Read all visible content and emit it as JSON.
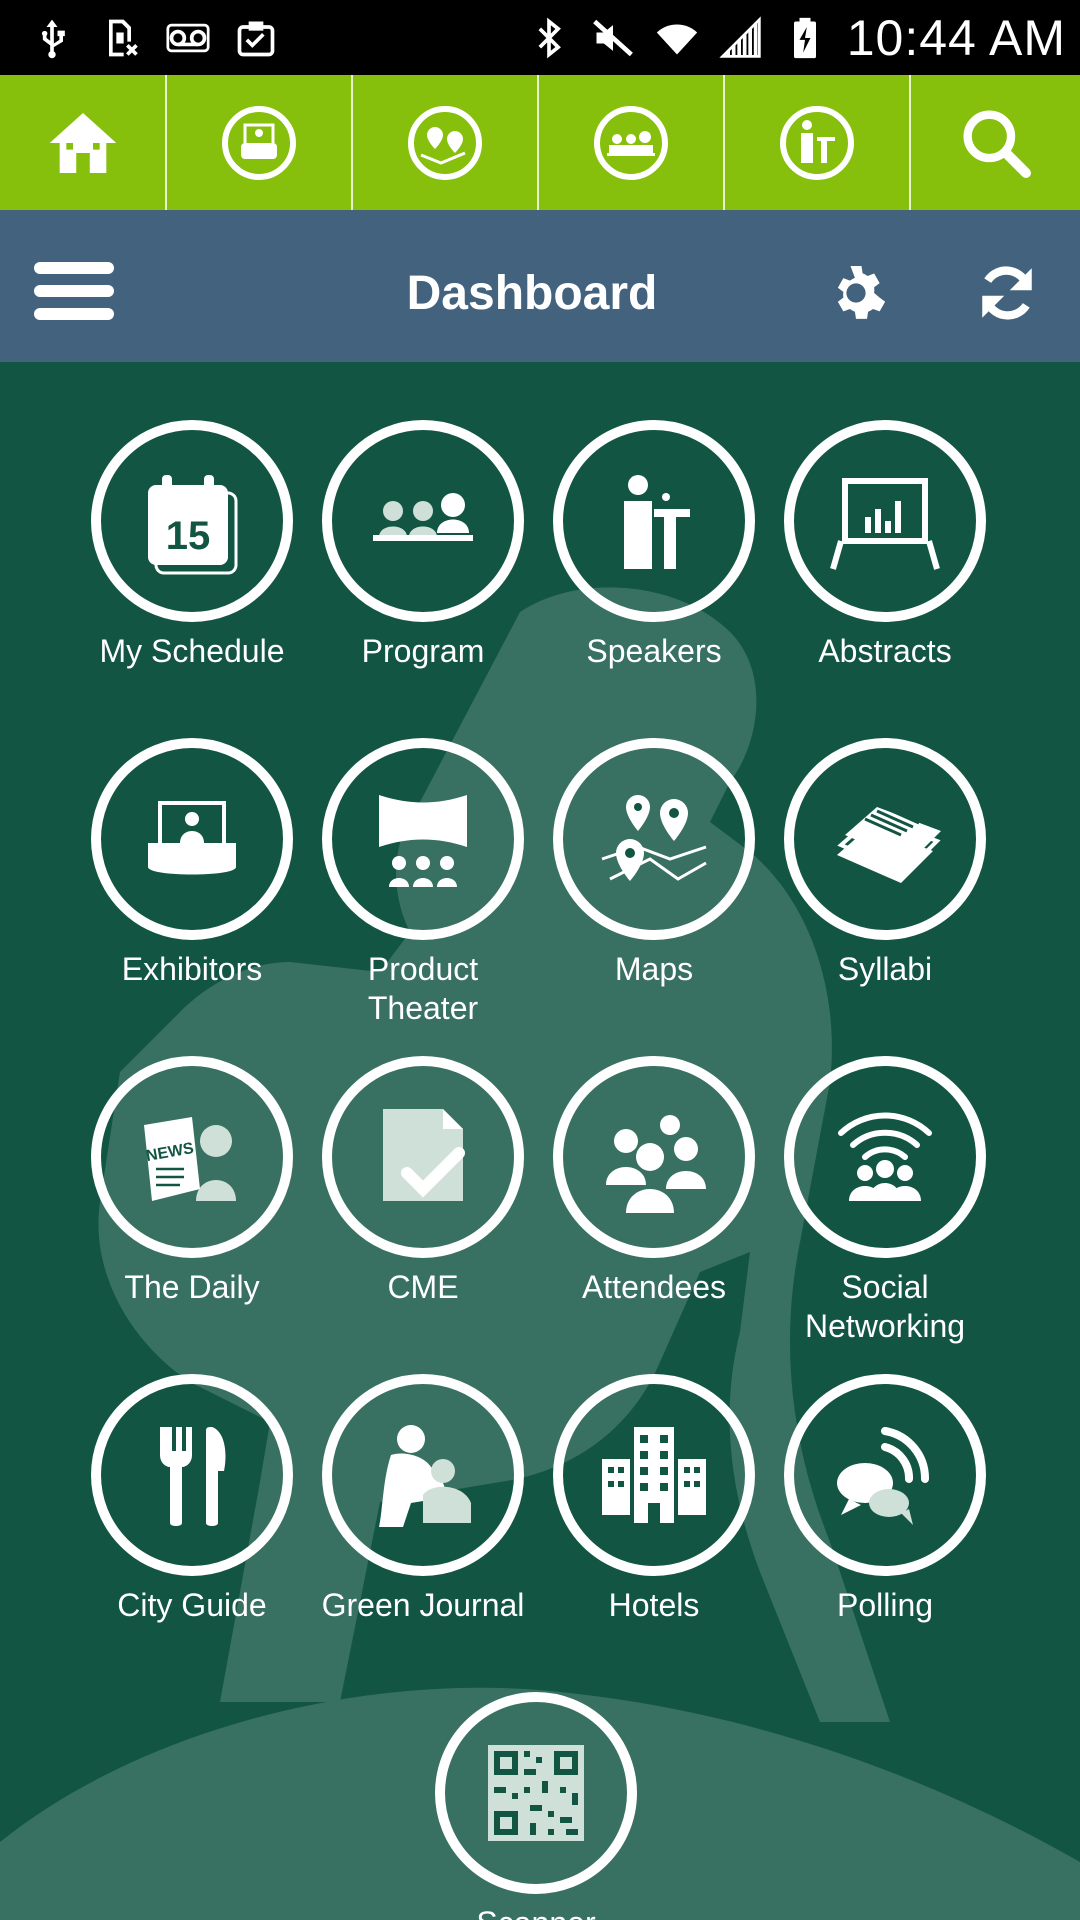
{
  "status_bar": {
    "time": "10:44 AM",
    "left_icons": [
      "usb-icon",
      "sim-card-off-icon",
      "voicemail-icon",
      "clipboard-check-icon"
    ],
    "right_icons": [
      "bluetooth-icon",
      "mute-icon",
      "wifi-icon",
      "signal-icon",
      "battery-charging-icon"
    ]
  },
  "top_nav": {
    "items": [
      {
        "icon": "home-icon"
      },
      {
        "icon": "exhibitor-booth-icon"
      },
      {
        "icon": "map-pins-icon"
      },
      {
        "icon": "audience-icon"
      },
      {
        "icon": "speaker-podium-icon"
      },
      {
        "icon": "search-icon"
      }
    ]
  },
  "header": {
    "title": "Dashboard",
    "menu_icon": "menu-icon",
    "settings_icon": "gear-icon",
    "refresh_icon": "refresh-icon"
  },
  "tiles": [
    {
      "label": "My Schedule",
      "icon": "calendar-icon"
    },
    {
      "label": "Program",
      "icon": "audience-icon"
    },
    {
      "label": "Speakers",
      "icon": "speaker-podium-icon"
    },
    {
      "label": "Abstracts",
      "icon": "presentation-board-icon"
    },
    {
      "label": "Exhibitors",
      "icon": "exhibitor-booth-icon"
    },
    {
      "label": "Product\nTheater",
      "icon": "theater-icon"
    },
    {
      "label": "Maps",
      "icon": "map-pins-icon"
    },
    {
      "label": "Syllabi",
      "icon": "documents-icon"
    },
    {
      "label": "The Daily",
      "icon": "newspaper-icon"
    },
    {
      "label": "CME",
      "icon": "certificate-check-icon"
    },
    {
      "label": "Attendees",
      "icon": "people-group-icon"
    },
    {
      "label": "Social\nNetworking",
      "icon": "social-broadcast-icon"
    },
    {
      "label": "City Guide",
      "icon": "fork-knife-icon"
    },
    {
      "label": "Green Journal",
      "icon": "mother-baby-icon"
    },
    {
      "label": "Hotels",
      "icon": "buildings-icon"
    },
    {
      "label": "Polling",
      "icon": "chat-bubbles-icon"
    },
    {
      "label": "Scanner",
      "icon": "qr-code-icon"
    }
  ]
}
